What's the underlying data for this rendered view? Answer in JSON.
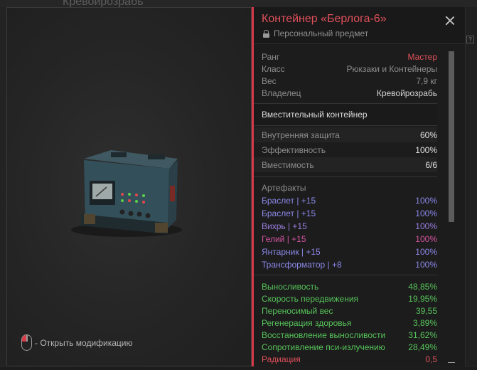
{
  "background": {
    "title": "Кревойрозрабь"
  },
  "preview": {
    "hint": "- Открыть модификацию",
    "mouse_icon": "mouse-left-click-icon"
  },
  "item": {
    "title": "Контейнер «Берлога-6»",
    "subtitle": "Персональный предмет",
    "info": [
      {
        "label": "Ранг",
        "value": "Мастер",
        "tone": "red"
      },
      {
        "label": "Класс",
        "value": "Рюкзаки и Контейнеры",
        "tone": "gray"
      },
      {
        "label": "Вес",
        "value": "7,9 кг",
        "tone": "gray"
      },
      {
        "label": "Владелец",
        "value": "Кревойрозрабь",
        "tone": "white"
      }
    ],
    "description": "Вместительный контейнер",
    "stats": [
      {
        "label": "Внутренняя защита",
        "value": "60%"
      },
      {
        "label": "Эффективность",
        "value": "100%"
      },
      {
        "label": "Вместимость",
        "value": "6/6"
      }
    ],
    "artifacts_title": "Артефакты",
    "artifacts": [
      {
        "name": "Браслет | +15",
        "value": "100%",
        "color": "#8b88e8"
      },
      {
        "name": "Браслет | +15",
        "value": "100%",
        "color": "#8b88e8"
      },
      {
        "name": "Вихрь | +15",
        "value": "100%",
        "color": "#9b7fe0"
      },
      {
        "name": "Гелий | +15",
        "value": "100%",
        "color": "#d454a0"
      },
      {
        "name": "Янтарник | +15",
        "value": "100%",
        "color": "#8b88e8"
      },
      {
        "name": "Трансформатор | +8",
        "value": "100%",
        "color": "#8b88e8"
      }
    ],
    "effects": [
      {
        "label": "Выносливость",
        "value": "48,85%"
      },
      {
        "label": "Скорость передвижения",
        "value": "19,95%"
      },
      {
        "label": "Переносимый вес",
        "value": "39,55"
      },
      {
        "label": "Регенерация здоровья",
        "value": "3,89%"
      },
      {
        "label": "Восстановление выносливости",
        "value": "31,62%"
      },
      {
        "label": "Сопротивление пси-излучению",
        "value": "28,49%"
      },
      {
        "label": "Радиация",
        "value": "0,5",
        "color": "#e0505b"
      }
    ]
  },
  "colors": {
    "accent": "#d63a48",
    "positive": "#56c35a"
  }
}
